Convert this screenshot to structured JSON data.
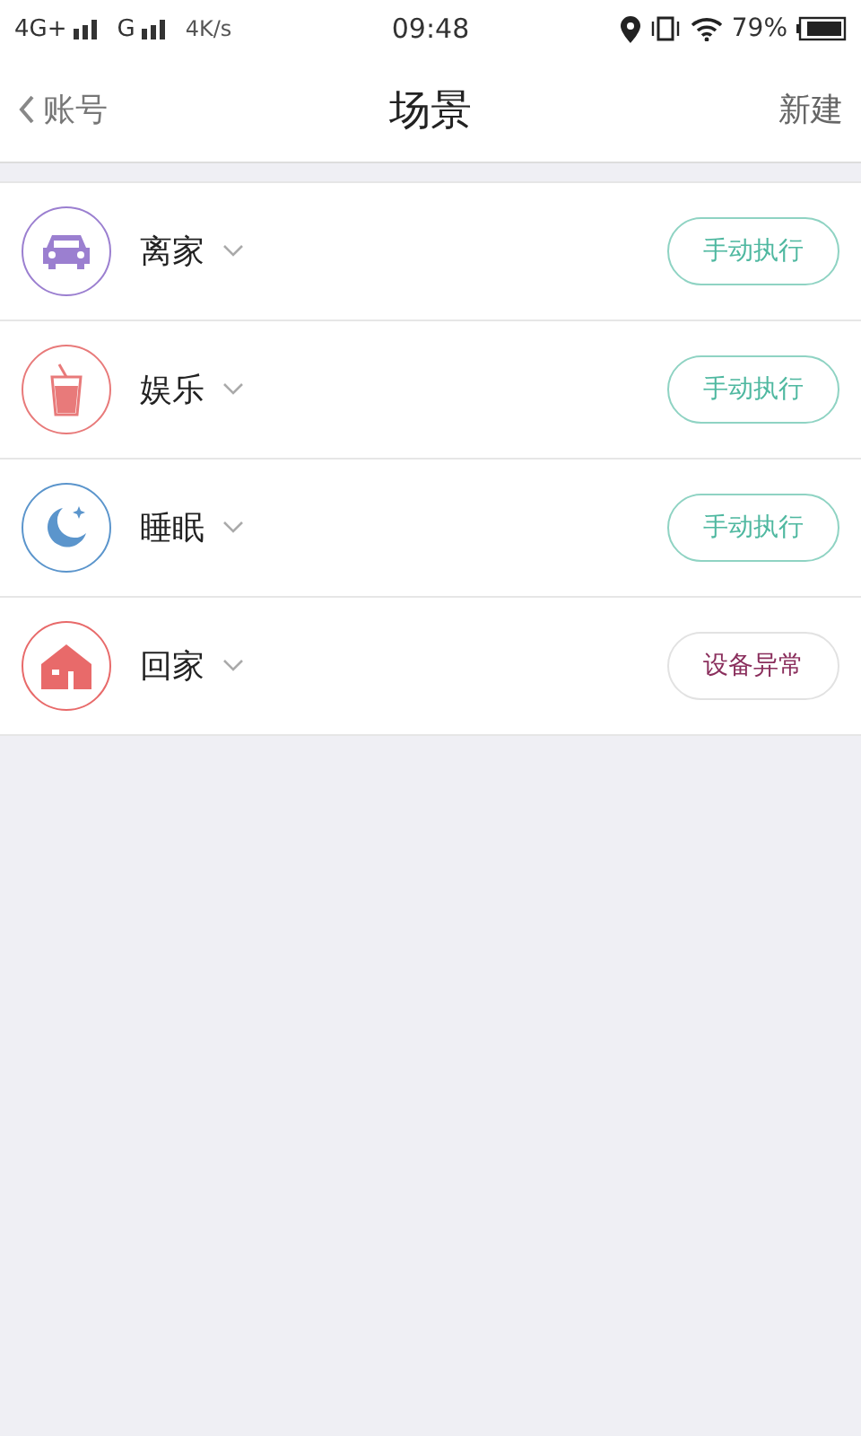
{
  "status_bar": {
    "network_1": "4G+",
    "network_2": "G",
    "speed": "4K/s",
    "time": "09:48",
    "battery": "79%"
  },
  "nav": {
    "back": "账号",
    "title": "场景",
    "action": "新建"
  },
  "scenes": [
    {
      "name": "离家",
      "kind": "car",
      "color": "#9b7fd0",
      "action": {
        "kind": "run",
        "label": "手动执行"
      }
    },
    {
      "name": "娱乐",
      "kind": "drink",
      "color": "#e87a7a",
      "action": {
        "kind": "run",
        "label": "手动执行"
      }
    },
    {
      "name": "睡眠",
      "kind": "moon",
      "color": "#5b95cc",
      "action": {
        "kind": "run",
        "label": "手动执行"
      }
    },
    {
      "name": "回家",
      "kind": "home",
      "color": "#e86a6a",
      "action": {
        "kind": "error",
        "label": "设备异常"
      }
    }
  ]
}
